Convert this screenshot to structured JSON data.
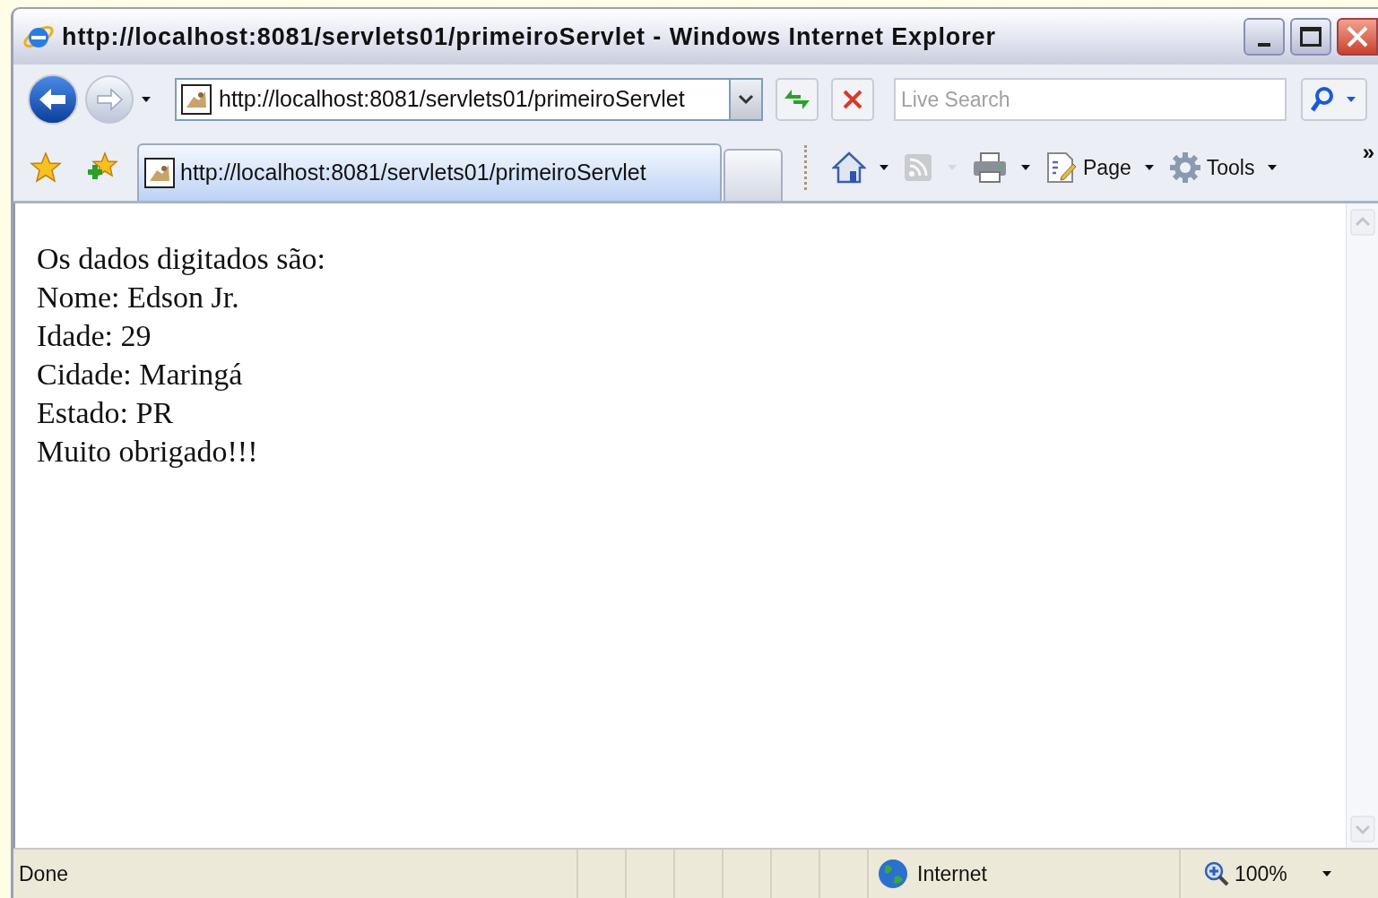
{
  "window": {
    "title": "http://localhost:8081/servlets01/primeiroServlet - Windows Internet Explorer"
  },
  "address_bar": {
    "value": "http://localhost:8081/servlets01/primeiroServlet"
  },
  "search": {
    "placeholder": "Live Search"
  },
  "tabs": [
    {
      "label": "http://localhost:8081/servlets01/primeiroServlet",
      "selected": true
    },
    {
      "selected": false
    }
  ],
  "command_bar": [
    {
      "kind": "home",
      "disabled": false
    },
    {
      "kind": "feeds",
      "disabled": true
    },
    {
      "kind": "print",
      "disabled": false
    },
    {
      "kind": "page",
      "label": "Page",
      "disabled": false
    },
    {
      "kind": "tools",
      "label": "Tools",
      "disabled": false
    }
  ],
  "overflow": "»",
  "page_content": [
    "Os dados digitados são:",
    "Nome: Edson Jr.",
    "Idade: 29",
    "Cidade: Maringá",
    "Estado: PR",
    "Muito obrigado!!!"
  ],
  "status_bar": {
    "status": "Done",
    "zone": "Internet",
    "zoom": "100%"
  }
}
